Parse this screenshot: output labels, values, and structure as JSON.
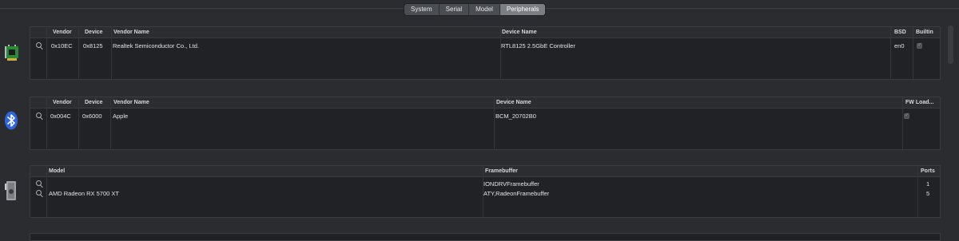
{
  "tabs": [
    "System",
    "Serial",
    "Model",
    "Peripherals"
  ],
  "active_tab": "Peripherals",
  "network": {
    "headers": [
      "Vendor",
      "Device",
      "Vendor Name",
      "Device Name",
      "BSD",
      "Builtin"
    ],
    "rows": [
      {
        "vendor": "0x10EC",
        "device": "0x8125",
        "vendor_name": "Realtek Semiconductor Co., Ltd.",
        "device_name": "RTL8125 2.5GbE Controller",
        "bsd": "en0",
        "builtin": true
      }
    ]
  },
  "bluetooth": {
    "headers": [
      "Vendor",
      "Device",
      "Vendor Name",
      "Device Name",
      "FW Load..."
    ],
    "rows": [
      {
        "vendor": "0x004C",
        "device": "0x6000",
        "vendor_name": "Apple",
        "device_name": "BCM_20702B0",
        "fw_load": true
      }
    ]
  },
  "graphics": {
    "headers": [
      "Model",
      "Framebuffer",
      "Ports"
    ],
    "rows": [
      {
        "model": "",
        "framebuffer": "IONDRVFramebuffer",
        "ports": "1"
      },
      {
        "model": "AMD Radeon RX 5700 XT",
        "framebuffer": "ATY,RadeonFramebuffer",
        "ports": "5"
      }
    ]
  },
  "colors": {
    "bluetooth": "#2f66e0",
    "pcb_green": "#2a8a3a"
  }
}
